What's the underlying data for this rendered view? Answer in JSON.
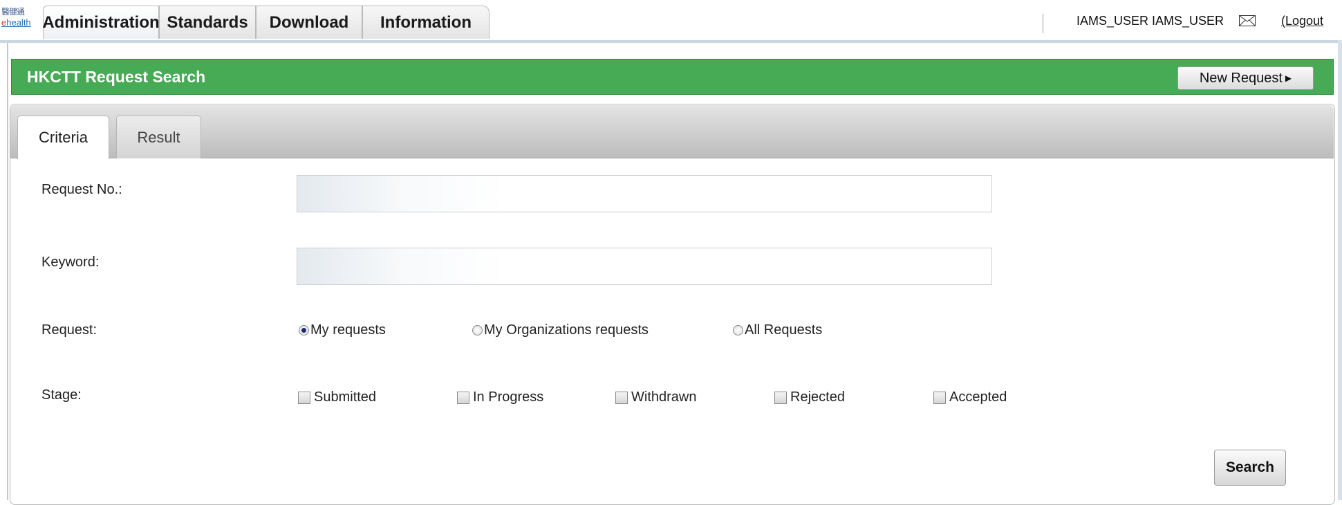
{
  "app": {
    "logo_line1": "醫健通",
    "logo_line2_prefix": "e",
    "logo_line2": "health"
  },
  "nav": {
    "tabs": [
      {
        "label": "Administration"
      },
      {
        "label": "Standards"
      },
      {
        "label": "Download"
      },
      {
        "label": "Information"
      }
    ],
    "user": "IAMS_USER IAMS_USER",
    "logout": "(Logout",
    "mail_icon": "envelope-icon"
  },
  "header": {
    "title": "HKCTT Request Search",
    "new_request": "New Request",
    "arrow": "▶"
  },
  "subtabs": {
    "criteria": "Criteria",
    "result": "Result"
  },
  "form": {
    "request_no_label": "Request No.:",
    "request_no_value": "",
    "keyword_label": "Keyword:",
    "keyword_value": "",
    "request_label": "Request:",
    "request_options": [
      {
        "label": "My requests",
        "selected": true
      },
      {
        "label": "My Organizations requests",
        "selected": false
      },
      {
        "label": "All Requests",
        "selected": false
      }
    ],
    "stage_label": "Stage:",
    "stage_options": [
      {
        "label": "Submitted",
        "checked": false
      },
      {
        "label": "In Progress",
        "checked": false
      },
      {
        "label": "Withdrawn",
        "checked": false
      },
      {
        "label": "Rejected",
        "checked": false
      },
      {
        "label": "Accepted",
        "checked": false
      }
    ],
    "search_button": "Search"
  },
  "colors": {
    "header_green": "#47ab55",
    "radio_selected": "#1b2b73"
  }
}
